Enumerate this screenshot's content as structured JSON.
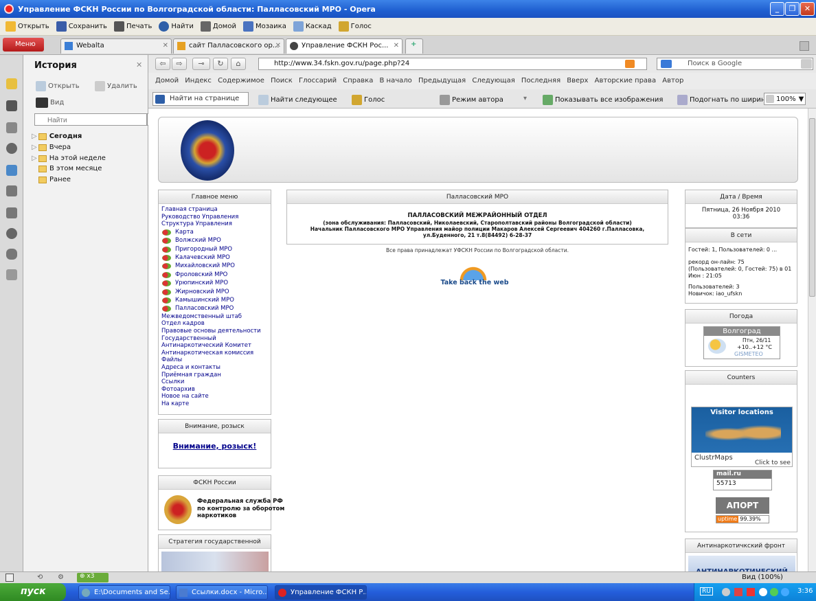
{
  "window": {
    "title": "Управление ФСКН России по Волгоградской области: Палласовский МРО - Opera"
  },
  "toolbar": {
    "items": [
      "Открыть",
      "Сохранить",
      "Печать",
      "Найти",
      "Домой",
      "Мозаика",
      "Каскад",
      "Голос"
    ]
  },
  "tabs": {
    "menu_label": "Меню",
    "items": [
      "Webalta",
      "сайт Палласовского ор...",
      "Управление ФСКН Рос..."
    ]
  },
  "history_panel": {
    "title": "История",
    "open_label": "Открыть",
    "delete_label": "Удалить",
    "view_label": "Вид",
    "search_placeholder": "Найти",
    "tree": [
      "Сегодня",
      "Вчера",
      "На этой неделе",
      "В этом месяце",
      "Ранее"
    ]
  },
  "address": {
    "url": "http://www.34.fskn.gov.ru/page.php?24",
    "search_placeholder": "Поиск в Google"
  },
  "nav_links": [
    "Домой",
    "Индекс",
    "Содержимое",
    "Поиск",
    "Глоссарий",
    "Справка",
    "В начало",
    "Предыдущая",
    "Следующая",
    "Последняя",
    "Вверх",
    "Авторские права",
    "Автор"
  ],
  "find_bar": {
    "find_placeholder": "Найти на странице",
    "find_next": "Найти следующее",
    "voice": "Голос",
    "author_mode": "Режим автора",
    "show_images": "Показывать все изображения",
    "fit_width": "Подогнать по ширине",
    "zoom": "100%"
  },
  "page": {
    "main_menu": {
      "title": "Главное меню",
      "items_top": [
        "Главная страница",
        "Руководство Управления",
        "Структура Управления"
      ],
      "items_icon": [
        "Карта",
        "Волжский МРО",
        "Пригородный МРО",
        "Калачевский МРО",
        "Михайловский МРО",
        "Фроловский МРО",
        "Урюпинский МРО",
        "Жирновский МРО",
        "Камышинский МРО",
        "Палласовский МРО"
      ],
      "items_bottom": [
        "Межведомственный штаб",
        "Отдел кадров",
        "Правовые основы деятельности",
        "Государственный",
        "Антинаркотический Комитет",
        "Антинаркотическая комиссия",
        "Файлы",
        "Адреса и контакты",
        "Приёмная граждан",
        "Ссылки",
        "Фотоархив",
        "Новое на сайте",
        "На карте"
      ]
    },
    "wanted_box": {
      "title": "Внимание, розыск",
      "link": "Внимание, розыск!"
    },
    "fskn_box": {
      "title": "ФСКН России",
      "text": "Федеральная служба РФ по контролю за оборотом наркотиков"
    },
    "strategy_box": {
      "title": "Стратегия государственной"
    },
    "center": {
      "title": "Палласовский МРО",
      "heading": "ПАЛЛАСОВСКИЙ МЕЖРАЙОННЫЙ ОТДЕЛ",
      "line1": "(зона обслуживания: Палласовский, Николаевский, Старополтавский районы Волгоградской области)",
      "line2": "Начальник Палласовского МРО Управления майор полиции Макаров Алексей Сергеевич 404260 г.Палласовка, ул.Буденного, 21 т.8(84492) 6-28-37",
      "copyright": "Все права принадлежат УФСКН России по Волгоградской области.",
      "banner": "Take back the web"
    },
    "datetime_box": {
      "title": "Дата / Время",
      "value1": "Пятница, 26 Ноября 2010",
      "value2": "03:36"
    },
    "online_box": {
      "title": "В сети",
      "guests": "Гостей: 1, Пользователей: 0 ...",
      "record": "рекорд он-лайн: 75 (Пользователей: 0, Гостей: 75) в 01 Июн : 21:05",
      "users": "Пользователей: 3",
      "newbie": "Новичок: iao_ufskn"
    },
    "weather_box": {
      "title": "Погода",
      "city": "Волгоград",
      "date": "Птн, 26/11",
      "temp": "+10..+12 °C",
      "source": "GISMETEO"
    },
    "counters_box": {
      "title": "Counters",
      "map_title": "Visitor locations",
      "map_brand": "ClustrMaps",
      "map_click": "Click to see",
      "mail_count": "55713",
      "aport": "АПОРТ",
      "uptime_label": "uptime",
      "uptime_value": "99.39%"
    },
    "antidrug_box": {
      "title": "Антинаркотичкский фронт",
      "banner": "АНТИНАРКОТИЧЕСКИЙ"
    }
  },
  "statusbar": {
    "view": "Вид (100%)"
  },
  "taskbar": {
    "start": "пуск",
    "tasks": [
      "E:\\Documents and Se...",
      "Ссылки.docx - Micro...",
      "Управление ФСКН Р..."
    ],
    "lang": "RU",
    "time": "3:36"
  }
}
